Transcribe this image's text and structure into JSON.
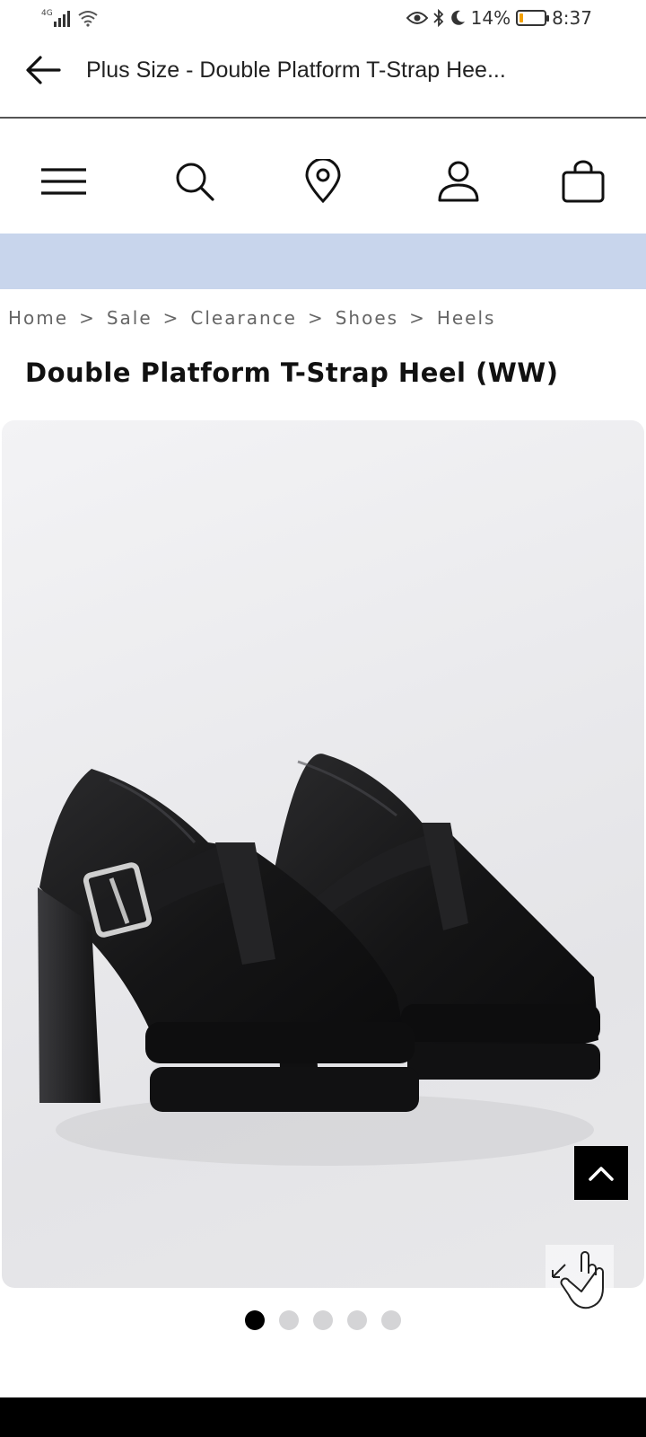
{
  "status_bar": {
    "network": "4G",
    "battery_percent": "14%",
    "battery_level": 0.14,
    "time": "8:37"
  },
  "app_header": {
    "title": "Plus Size - Double Platform T-Strap Hee..."
  },
  "site_nav": {
    "icons": [
      "menu-icon",
      "search-icon",
      "location-pin-icon",
      "account-icon",
      "bag-icon"
    ]
  },
  "breadcrumb": {
    "items": [
      "Home",
      "Sale",
      "Clearance",
      "Shoes",
      "Heels"
    ],
    "separator": ">"
  },
  "product": {
    "title": "Double Platform T-Strap Heel (WW)"
  },
  "gallery": {
    "image_count": 5,
    "active_index": 0
  },
  "colors": {
    "promo_banner": "#c8d5ec",
    "accent": "#000000"
  }
}
